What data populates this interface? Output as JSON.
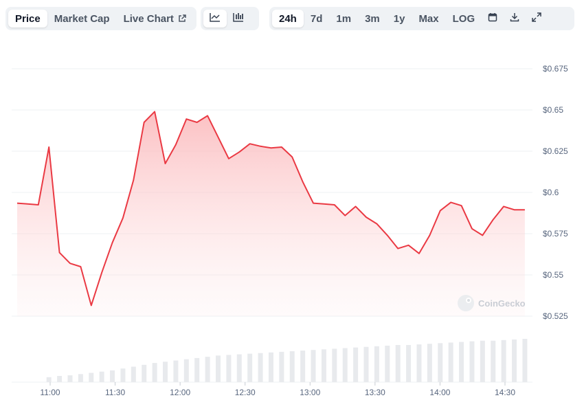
{
  "toolbar": {
    "metric_tabs": [
      "Price",
      "Market Cap",
      "Live Chart"
    ],
    "active_metric": "Price",
    "chart_types": [
      "line-chart-icon",
      "bar-chart-icon"
    ],
    "ranges": [
      "24h",
      "7d",
      "1m",
      "3m",
      "1y",
      "Max",
      "LOG"
    ],
    "active_range": "24h",
    "tools": [
      "calendar-icon",
      "download-icon",
      "expand-icon"
    ]
  },
  "watermark": "CoinGecko",
  "colors": {
    "line": "#ea3943",
    "area_top": "#fbb5b8",
    "grid": "#eef0f3",
    "volume": "#e8eaed",
    "axis_text": "#58667e"
  },
  "chart_data": {
    "type": "area",
    "title": "",
    "xlabel": "",
    "ylabel": "",
    "x_ticks": [
      "11:00",
      "11:30",
      "12:00",
      "12:30",
      "13:00",
      "13:30",
      "14:00",
      "14:30"
    ],
    "y_ticks": [
      "$0.525",
      "$0.55",
      "$0.575",
      "$0.6",
      "$0.625",
      "$0.65",
      "$0.675"
    ],
    "ylim": [
      0.525,
      0.675
    ],
    "xlim": [
      "10:52",
      "14:53"
    ],
    "grid": true,
    "series": [
      {
        "x": [
          "10:52",
          "10:57",
          "11:02",
          "11:07",
          "11:12",
          "11:17",
          "11:22",
          "11:27",
          "11:32",
          "11:37",
          "11:42",
          "11:47",
          "11:52",
          "11:57",
          "12:02",
          "12:07",
          "12:12",
          "12:17",
          "12:22",
          "12:27",
          "12:32",
          "12:37",
          "12:42",
          "12:47",
          "12:52",
          "12:57",
          "13:02",
          "13:07",
          "13:12",
          "13:17",
          "13:22",
          "13:27",
          "13:32",
          "13:37",
          "13:42",
          "13:47",
          "13:52",
          "13:57",
          "14:02",
          "14:07",
          "14:12",
          "14:17",
          "14:22",
          "14:27",
          "14:32",
          "14:37",
          "14:42",
          "14:47",
          "14:52"
        ],
        "values": [
          0.5935,
          0.593,
          0.5925,
          0.6275,
          0.5635,
          0.557,
          0.555,
          0.5315,
          0.5515,
          0.5695,
          0.5845,
          0.6075,
          0.6425,
          0.649,
          0.6175,
          0.629,
          0.6445,
          0.6425,
          0.6465,
          0.6335,
          0.6205,
          0.6245,
          0.6295,
          0.628,
          0.627,
          0.6275,
          0.6215,
          0.6065,
          0.5935,
          0.593,
          0.5925,
          0.586,
          0.5915,
          0.585,
          0.581,
          0.574,
          0.566,
          0.568,
          0.563,
          0.574,
          0.589,
          0.594,
          0.592,
          0.578,
          0.574,
          0.5835,
          0.5915,
          0.5895,
          0.5895
        ]
      }
    ],
    "volume": {
      "x": [
        "11:07",
        "11:12",
        "11:17",
        "11:22",
        "11:27",
        "11:32",
        "11:37",
        "11:42",
        "11:47",
        "11:52",
        "11:57",
        "12:02",
        "12:07",
        "12:12",
        "12:17",
        "12:22",
        "12:27",
        "12:32",
        "12:37",
        "12:42",
        "12:47",
        "12:52",
        "12:57",
        "13:02",
        "13:07",
        "13:12",
        "13:17",
        "13:22",
        "13:27",
        "13:32",
        "13:37",
        "13:42",
        "13:47",
        "13:52",
        "13:57",
        "14:02",
        "14:07",
        "14:12",
        "14:17",
        "14:22",
        "14:27",
        "14:32",
        "14:37",
        "14:42",
        "14:47",
        "14:52"
      ],
      "values": [
        0.08,
        0.1,
        0.11,
        0.13,
        0.15,
        0.17,
        0.19,
        0.22,
        0.25,
        0.28,
        0.31,
        0.33,
        0.35,
        0.37,
        0.39,
        0.41,
        0.43,
        0.44,
        0.45,
        0.46,
        0.47,
        0.48,
        0.49,
        0.5,
        0.51,
        0.52,
        0.53,
        0.54,
        0.55,
        0.56,
        0.57,
        0.58,
        0.59,
        0.6,
        0.6,
        0.61,
        0.62,
        0.63,
        0.64,
        0.65,
        0.66,
        0.67,
        0.67,
        0.68,
        0.69,
        0.7
      ]
    }
  }
}
